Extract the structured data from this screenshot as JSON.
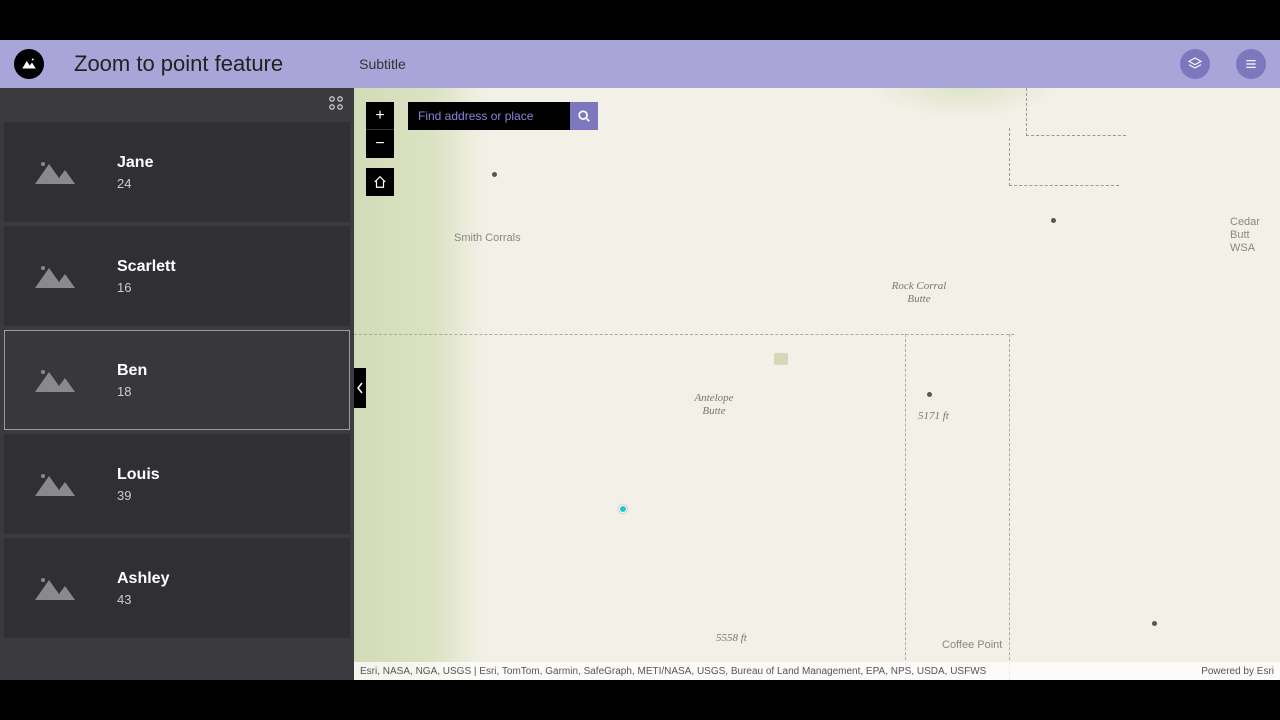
{
  "header": {
    "title": "Zoom to point feature",
    "subtitle": "Subtitle"
  },
  "search": {
    "placeholder": "Find address or place"
  },
  "sidebar": {
    "items": [
      {
        "name": "Jane",
        "value": "24",
        "selected": false
      },
      {
        "name": "Scarlett",
        "value": "16",
        "selected": false
      },
      {
        "name": "Ben",
        "value": "18",
        "selected": true
      },
      {
        "name": "Louis",
        "value": "39",
        "selected": false
      },
      {
        "name": "Ashley",
        "value": "43",
        "selected": false
      }
    ]
  },
  "map": {
    "labels": {
      "smith_corrals": "Smith Corrals",
      "rock_corral_butte_l1": "Rock Corral",
      "rock_corral_butte_l2": "Butte",
      "antelope_l1": "Antelope",
      "antelope_l2": "Butte",
      "elev1": "5171 ft",
      "elev2": "5558 ft",
      "coffee_point": "Coffee Point",
      "cedar_l1": "Cedar Butt",
      "cedar_l2": "WSA"
    },
    "attribution_left": "Esri, NASA, NGA, USGS | Esri, TomTom, Garmin, SafeGraph, METI/NASA, USGS, Bureau of Land Management, EPA, NPS, USDA, USFWS",
    "attribution_right": "Powered by Esri"
  },
  "controls": {
    "zoom_in": "+",
    "zoom_out": "−"
  }
}
